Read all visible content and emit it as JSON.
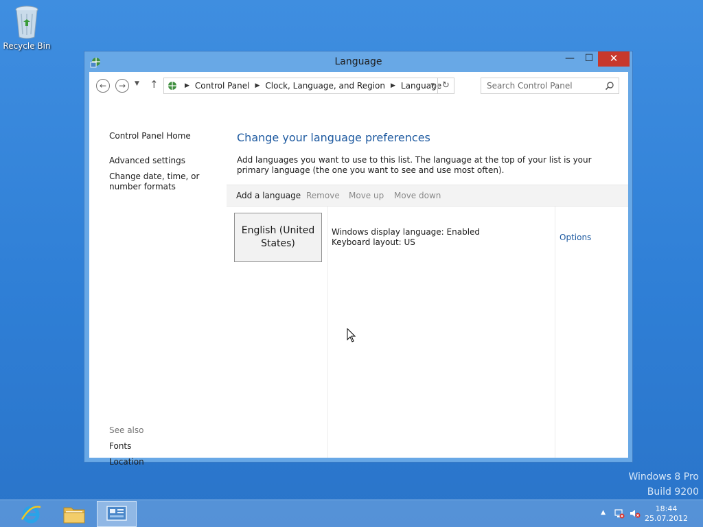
{
  "desktop": {
    "recycle_bin_label": "Recycle Bin"
  },
  "window": {
    "title": "Language",
    "controls": {
      "minimize": "—",
      "maximize": "☐",
      "close": "✕"
    }
  },
  "navbar": {
    "breadcrumbs": [
      "Control Panel",
      "Clock, Language, and Region",
      "Language"
    ],
    "search_placeholder": "Search Control Panel"
  },
  "left_pane": {
    "home": "Control Panel Home",
    "advanced": "Advanced settings",
    "date_formats": "Change date, time, or number formats",
    "see_also": "See also",
    "fonts": "Fonts",
    "location": "Location"
  },
  "main": {
    "title": "Change your language preferences",
    "description": "Add languages you want to use to this list. The language at the top of your list is your primary language (the one you want to see and use most often).",
    "toolbar": {
      "add": "Add a language",
      "remove": "Remove",
      "move_up": "Move up",
      "move_down": "Move down"
    },
    "languages": [
      {
        "name": "English (United States)",
        "display_language": "Windows display language: Enabled",
        "keyboard": "Keyboard layout: US",
        "options": "Options"
      }
    ]
  },
  "watermark": {
    "line1": "Windows 8 Pro",
    "line2": "Build 9200"
  },
  "taskbar": {
    "time": "18:44",
    "date": "25.07.2012"
  },
  "colors": {
    "desktop": "#2f7fd6",
    "window_frame": "#68a8e6",
    "close_button": "#c7382c",
    "link_blue": "#1e5aa0"
  }
}
